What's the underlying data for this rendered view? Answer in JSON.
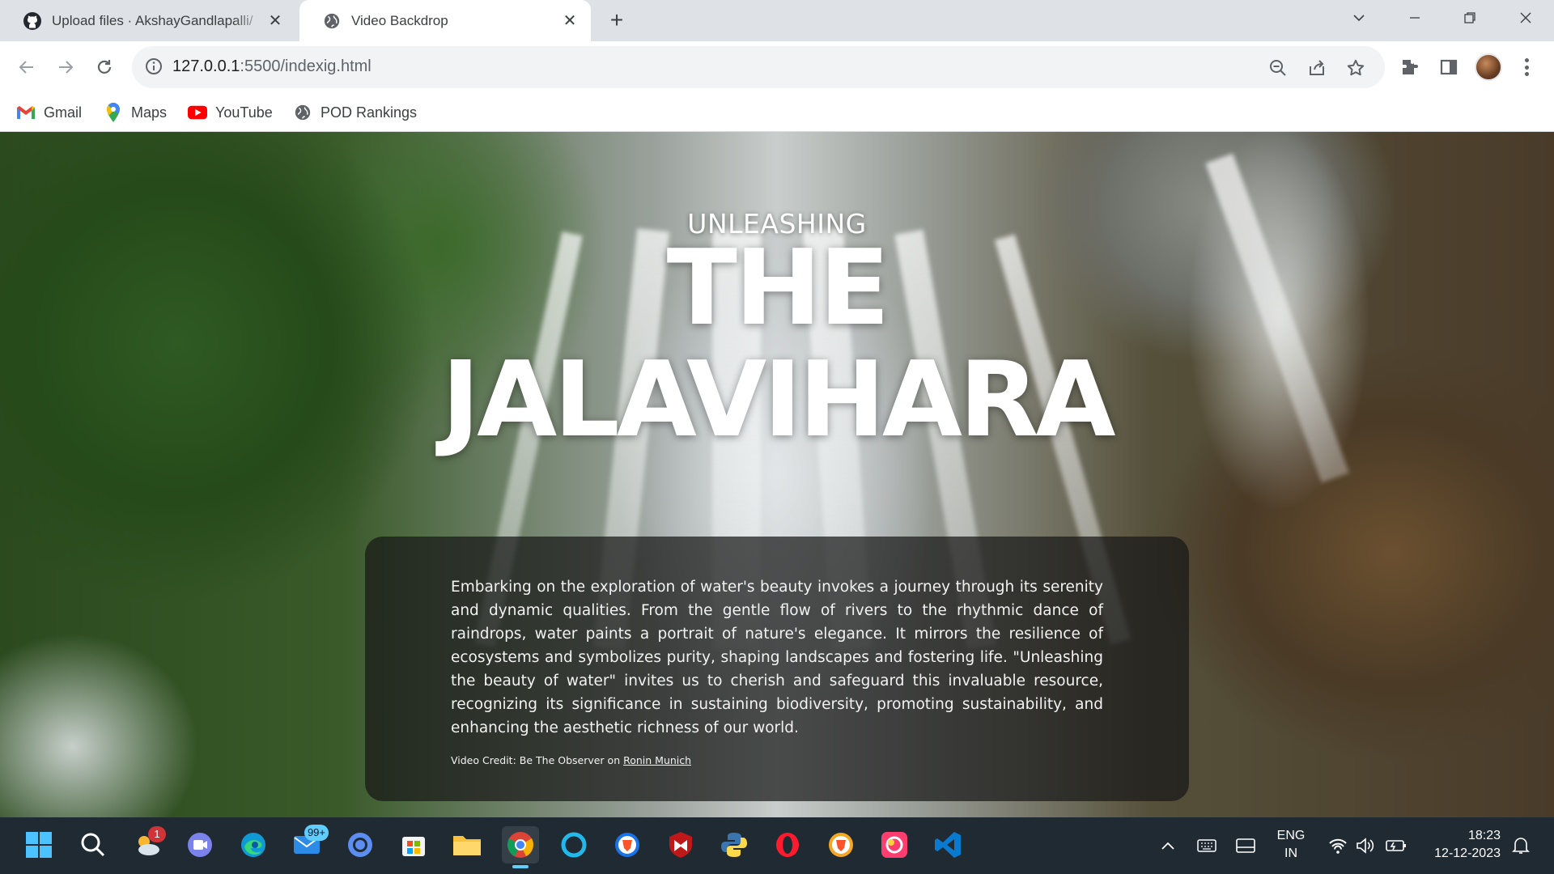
{
  "browser": {
    "tabs": [
      {
        "title": "Upload files · AkshayGandlapalli/",
        "icon": "github-icon"
      },
      {
        "title": "Video Backdrop",
        "icon": "globe-icon"
      }
    ],
    "new_tab_glyph": "+",
    "url_host": "127.0.0.1",
    "url_rest": ":5500/indexig.html",
    "bookmarks": [
      {
        "label": "Gmail",
        "icon": "gmail-icon"
      },
      {
        "label": "Maps",
        "icon": "maps-icon"
      },
      {
        "label": "YouTube",
        "icon": "youtube-icon"
      },
      {
        "label": "POD Rankings",
        "icon": "globe-icon"
      }
    ]
  },
  "page": {
    "kicker": "UNLEASHING",
    "title_line1": "THE",
    "title_line2": "JALAVIHARA",
    "description": "Embarking on the exploration of water's beauty invokes a journey through its serenity and dynamic qualities. From the gentle flow of rivers to the rhythmic dance of raindrops, water paints a portrait of nature's elegance. It mirrors the resilience of ecosystems and symbolizes purity, shaping landscapes and fostering life. \"Unleashing the beauty of water\" invites us to cherish and safeguard this invaluable resource, recognizing its significance in sustaining biodiversity, promoting sustainability, and enhancing the aesthetic richness of our world.",
    "credit_prefix": "Video Credit: Be The Observer on ",
    "credit_link": "Ronin Munich"
  },
  "taskbar": {
    "apps": [
      "start-icon",
      "search-icon",
      "weather-widget-icon",
      "teams-icon",
      "edge-icon",
      "mail-icon",
      "chrome-alt-icon",
      "store-icon",
      "file-explorer-icon",
      "chrome-icon",
      "cortana-icon",
      "brave-icon",
      "mcafee-icon",
      "python-icon",
      "opera-icon",
      "brave-beta-icon",
      "photo-app-icon",
      "vscode-icon"
    ],
    "weather_badge": "1",
    "mail_badge": "99+",
    "lang_line1": "ENG",
    "lang_line2": "IN",
    "time": "18:23",
    "date": "12-12-2023"
  },
  "colors": {
    "tab_strip": "#dee1e6",
    "taskbar": "#1f2a33",
    "accent": "#60cdff",
    "card_bg": "rgba(24,24,24,0.72)"
  }
}
